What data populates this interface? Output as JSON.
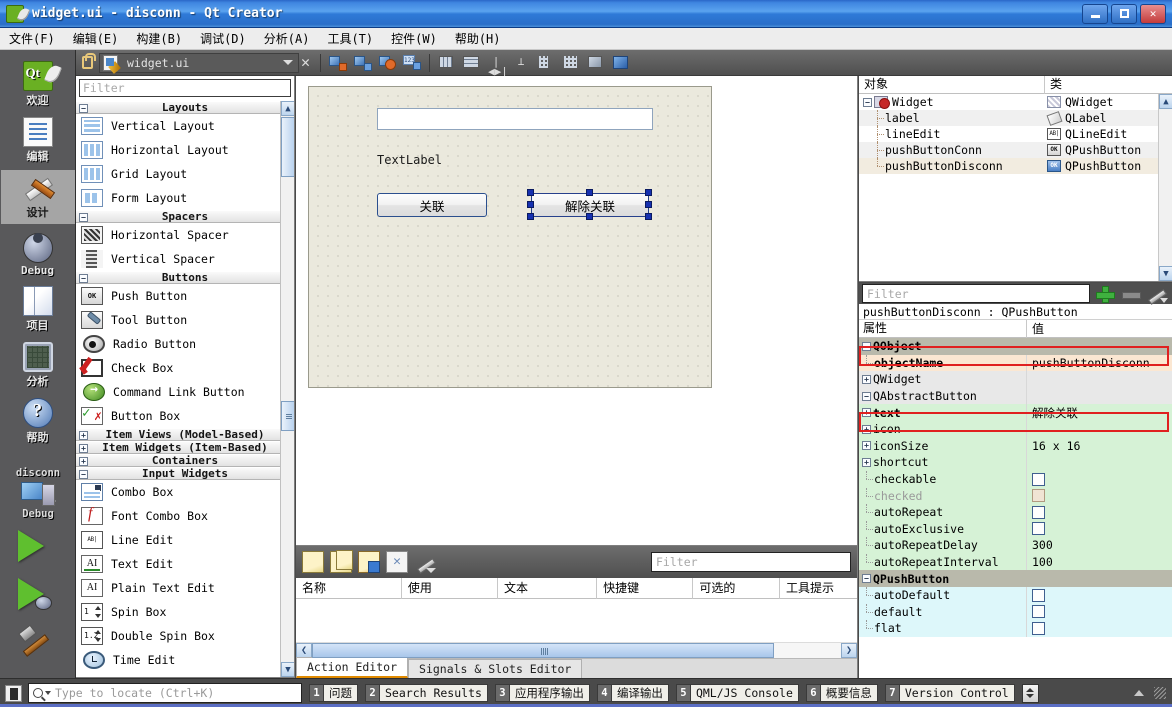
{
  "window": {
    "title": "widget.ui - disconn - Qt Creator",
    "logo_icon": "qt-logo-icon",
    "minimize_label": "_",
    "maximize_label": "□",
    "close_label": "✕"
  },
  "menubar": {
    "items": [
      {
        "label": "文件(F)",
        "name": "menu-file"
      },
      {
        "label": "编辑(E)",
        "name": "menu-edit"
      },
      {
        "label": "构建(B)",
        "name": "menu-build"
      },
      {
        "label": "调试(D)",
        "name": "menu-debug"
      },
      {
        "label": "分析(A)",
        "name": "menu-analyze"
      },
      {
        "label": "工具(T)",
        "name": "menu-tools"
      },
      {
        "label": "控件(W)",
        "name": "menu-window"
      },
      {
        "label": "帮助(H)",
        "name": "menu-help"
      }
    ]
  },
  "modebar": {
    "items": [
      {
        "label": "欢迎",
        "icon": "qt-welcome-icon",
        "active": false
      },
      {
        "label": "编辑",
        "icon": "edit-document-icon",
        "active": false
      },
      {
        "label": "设计",
        "icon": "design-pencil-ruler-icon",
        "active": true
      },
      {
        "label": "Debug",
        "icon": "debug-bug-icon",
        "active": false
      },
      {
        "label": "项目",
        "icon": "projects-folder-icon",
        "active": false
      },
      {
        "label": "分析",
        "icon": "analyze-monitor-icon",
        "active": false
      },
      {
        "label": "帮助",
        "icon": "help-question-icon",
        "active": false
      }
    ],
    "kit": {
      "label": "disconn",
      "build": "Debug",
      "icon": "target-computer-icon"
    },
    "run_button": "run-green-triangle-icon",
    "debug_button": "run-debug-icon",
    "build_button": "build-hammer-icon"
  },
  "editor_toolbar": {
    "lock_icon": "unlocked-icon",
    "file_icon": "ui-file-icon",
    "filename": "widget.ui",
    "dropdown_icon": "chevron-down-icon",
    "close_icon": "close-document-icon",
    "tools": [
      {
        "name": "send-to-back-icon"
      },
      {
        "name": "send-to-front-icon"
      },
      {
        "name": "edit-signals-slots-icon"
      },
      {
        "name": "edit-tab-order-icon"
      },
      {
        "name": "layout-horizontally-icon"
      },
      {
        "name": "layout-vertically-icon"
      },
      {
        "name": "layout-splitter-horizontal-icon"
      },
      {
        "name": "layout-splitter-vertical-icon"
      },
      {
        "name": "layout-form-icon"
      },
      {
        "name": "layout-grid-icon"
      },
      {
        "name": "break-layout-icon"
      },
      {
        "name": "adjust-size-icon"
      }
    ]
  },
  "widgetbox": {
    "filter_placeholder": "Filter",
    "groups": [
      {
        "title": "Layouts",
        "expanded": true,
        "toggle": "−",
        "items": [
          {
            "label": "Vertical Layout",
            "icon": "vertical-layout-icon",
            "cls": "w-vlay"
          },
          {
            "label": "Horizontal Layout",
            "icon": "horizontal-layout-icon",
            "cls": "w-hlay"
          },
          {
            "label": "Grid Layout",
            "icon": "grid-layout-icon",
            "cls": "w-glay"
          },
          {
            "label": "Form Layout",
            "icon": "form-layout-icon",
            "cls": "w-flay"
          }
        ]
      },
      {
        "title": "Spacers",
        "expanded": true,
        "toggle": "−",
        "items": [
          {
            "label": "Horizontal Spacer",
            "icon": "horizontal-spacer-icon",
            "cls": "w-hspc"
          },
          {
            "label": "Vertical Spacer",
            "icon": "vertical-spacer-icon",
            "cls": "w-vspc"
          }
        ]
      },
      {
        "title": "Buttons",
        "expanded": true,
        "toggle": "−",
        "items": [
          {
            "label": "Push Button",
            "icon": "push-button-icon",
            "cls": "w-push",
            "glyph": "OK"
          },
          {
            "label": "Tool Button",
            "icon": "tool-button-icon",
            "cls": "w-tool"
          },
          {
            "label": "Radio Button",
            "icon": "radio-button-icon",
            "cls": "w-radio"
          },
          {
            "label": "Check Box",
            "icon": "check-box-icon",
            "cls": "w-check"
          },
          {
            "label": "Command Link Button",
            "icon": "command-link-button-icon",
            "cls": "w-cmdlink"
          },
          {
            "label": "Button Box",
            "icon": "button-box-icon",
            "cls": "w-btnbox"
          }
        ]
      },
      {
        "title": "Item Views (Model-Based)",
        "expanded": false,
        "toggle": "+",
        "items": []
      },
      {
        "title": "Item Widgets (Item-Based)",
        "expanded": false,
        "toggle": "+",
        "items": []
      },
      {
        "title": "Containers",
        "expanded": false,
        "toggle": "+",
        "items": []
      },
      {
        "title": "Input Widgets",
        "expanded": true,
        "toggle": "−",
        "items": [
          {
            "label": "Combo Box",
            "icon": "combo-box-icon",
            "cls": "w-combo"
          },
          {
            "label": "Font Combo Box",
            "icon": "font-combo-box-icon",
            "cls": "w-fcombo"
          },
          {
            "label": "Line Edit",
            "icon": "line-edit-icon",
            "cls": "w-line",
            "glyph": "AB|"
          },
          {
            "label": "Text Edit",
            "icon": "text-edit-icon",
            "cls": "w-textedit",
            "glyph": "AI"
          },
          {
            "label": "Plain Text Edit",
            "icon": "plain-text-edit-icon",
            "cls": "w-plain",
            "glyph": "AI"
          },
          {
            "label": "Spin Box",
            "icon": "spin-box-icon",
            "cls": "w-spin",
            "glyph": "1"
          },
          {
            "label": "Double Spin Box",
            "icon": "double-spin-box-icon",
            "cls": "w-spin",
            "glyph": "1.2"
          },
          {
            "label": "Time Edit",
            "icon": "time-edit-icon",
            "cls": "w-time"
          }
        ]
      }
    ],
    "scroll_up": "▲",
    "scroll_down": "▼"
  },
  "form": {
    "lineedit_value": "",
    "label_text": "TextLabel",
    "button_conn": "关联",
    "button_disconn": "解除关联",
    "selected_widget": "pushButtonDisconn"
  },
  "action_editor": {
    "toolbar": [
      {
        "name": "new-action-icon"
      },
      {
        "name": "copy-action-icon"
      },
      {
        "name": "paste-action-icon"
      },
      {
        "name": "delete-action-icon"
      },
      {
        "name": "action-tools-icon"
      }
    ],
    "filter_placeholder": "Filter",
    "columns": [
      {
        "label": "名称",
        "width": 110
      },
      {
        "label": "使用",
        "width": 100
      },
      {
        "label": "文本",
        "width": 103
      },
      {
        "label": "快捷键",
        "width": 100
      },
      {
        "label": "可选的",
        "width": 90
      },
      {
        "label": "工具提示",
        "width": 80
      }
    ],
    "rows": [],
    "tabs": [
      {
        "label": "Action Editor",
        "active": true
      },
      {
        "label": "Signals & Slots Editor",
        "active": false
      }
    ],
    "scroll_left": "❮",
    "scroll_right": "❯"
  },
  "object_inspector": {
    "columns": [
      {
        "label": "对象"
      },
      {
        "label": "类"
      }
    ],
    "rows": [
      {
        "name": "Widget",
        "cls": "QWidget",
        "depth": 0,
        "expander": "−",
        "icon": "qwidget-icon",
        "selected": false,
        "alt": false
      },
      {
        "name": "label",
        "cls": "QLabel",
        "depth": 1,
        "expander": "",
        "icon": "qlabel-icon",
        "selected": false,
        "alt": true
      },
      {
        "name": "lineEdit",
        "cls": "QLineEdit",
        "depth": 1,
        "expander": "",
        "icon": "qlineedit-icon",
        "selected": false,
        "alt": false
      },
      {
        "name": "pushButtonConn",
        "cls": "QPushButton",
        "depth": 1,
        "expander": "",
        "icon": "qpushbutton-icon",
        "selected": false,
        "alt": true
      },
      {
        "name": "pushButtonDisconn",
        "cls": "QPushButton",
        "depth": 1,
        "expander": "",
        "icon": "qpushbutton-icon",
        "selected": true,
        "alt": false
      }
    ],
    "scroll_up": "▲",
    "scroll_down": "▼"
  },
  "property_editor": {
    "filter_placeholder": "Filter",
    "add_icon": "add-property-icon",
    "remove_icon": "remove-property-icon",
    "config_icon": "configure-icon",
    "subject": "pushButtonDisconn : QPushButton",
    "columns": [
      {
        "label": "属性"
      },
      {
        "label": "值"
      }
    ],
    "rows": [
      {
        "key": "QObject",
        "value": "",
        "kind": "group",
        "expander": "−",
        "bold": true
      },
      {
        "key": "objectName",
        "value": "pushButtonDisconn",
        "kind": "obj",
        "expander": "",
        "bold": true,
        "highlight": true
      },
      {
        "key": "QWidget",
        "value": "",
        "kind": "widget",
        "expander": "+",
        "bold": true
      },
      {
        "key": "QAbstractButton",
        "value": "",
        "kind": "widget",
        "expander": "−",
        "bold": true
      },
      {
        "key": "text",
        "value": "解除关联",
        "kind": "abs",
        "expander": "+",
        "bold": true,
        "highlight": true
      },
      {
        "key": "icon",
        "value": "",
        "kind": "abs",
        "expander": "+",
        "bold": false
      },
      {
        "key": "iconSize",
        "value": "16 x 16",
        "kind": "abs",
        "expander": "+",
        "bold": false
      },
      {
        "key": "shortcut",
        "value": "",
        "kind": "abs",
        "expander": "+",
        "bold": false
      },
      {
        "key": "checkable",
        "value": "",
        "kind": "abs",
        "expander": "",
        "bold": false,
        "checkbox": "unchecked"
      },
      {
        "key": "checked",
        "value": "",
        "kind": "abs-dim",
        "expander": "",
        "bold": false,
        "checkbox": "disabled"
      },
      {
        "key": "autoRepeat",
        "value": "",
        "kind": "abs",
        "expander": "",
        "bold": false,
        "checkbox": "unchecked"
      },
      {
        "key": "autoExclusive",
        "value": "",
        "kind": "abs",
        "expander": "",
        "bold": false,
        "checkbox": "unchecked"
      },
      {
        "key": "autoRepeatDelay",
        "value": "300",
        "kind": "abs",
        "expander": "",
        "bold": false
      },
      {
        "key": "autoRepeatInterval",
        "value": "100",
        "kind": "abs",
        "expander": "",
        "bold": false
      },
      {
        "key": "QPushButton",
        "value": "",
        "kind": "group",
        "expander": "−",
        "bold": true
      },
      {
        "key": "autoDefault",
        "value": "",
        "kind": "push",
        "expander": "",
        "bold": false,
        "checkbox": "unchecked"
      },
      {
        "key": "default",
        "value": "",
        "kind": "push",
        "expander": "",
        "bold": false,
        "checkbox": "unchecked"
      },
      {
        "key": "flat",
        "value": "",
        "kind": "push",
        "expander": "",
        "bold": false,
        "checkbox": "unchecked"
      }
    ],
    "highlight_color": "#e02020"
  },
  "statusbar": {
    "mode_icon": "output-pane-toggle-icon",
    "locator_placeholder": "Type to locate (Ctrl+K)",
    "search_icon": "search-icon",
    "panes": [
      {
        "num": "1",
        "label": "问题"
      },
      {
        "num": "2",
        "label": "Search Results"
      },
      {
        "num": "3",
        "label": "应用程序输出"
      },
      {
        "num": "4",
        "label": "编译输出"
      },
      {
        "num": "5",
        "label": "QML/JS Console"
      },
      {
        "num": "6",
        "label": "概要信息"
      },
      {
        "num": "7",
        "label": "Version Control"
      }
    ],
    "updown_icon": "updown-spinner-icon",
    "expand_icon": "expand-output-icon",
    "grip_icon": "resize-grip-icon"
  }
}
